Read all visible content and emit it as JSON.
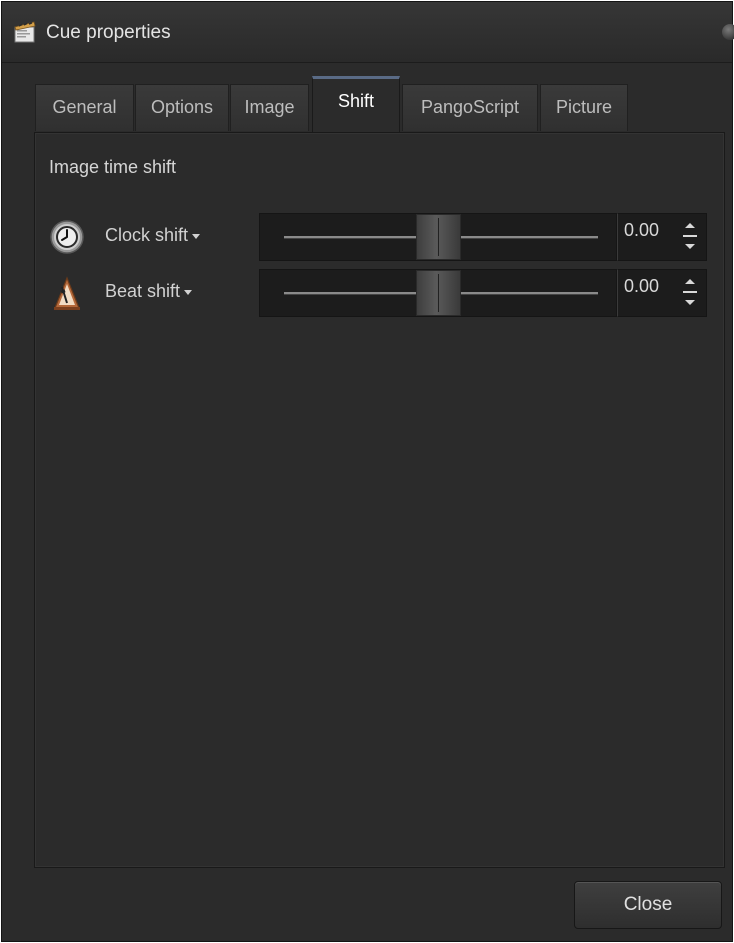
{
  "window": {
    "title": "Cue properties",
    "title_icon": "cue-properties-icon"
  },
  "tabs": [
    {
      "label": "General",
      "active": false
    },
    {
      "label": "Options",
      "active": false
    },
    {
      "label": "Image",
      "active": false
    },
    {
      "label": "Shift",
      "active": true
    },
    {
      "label": "PangoScript",
      "active": false
    },
    {
      "label": "Picture",
      "active": false
    }
  ],
  "panel": {
    "section_title": "Image time shift",
    "rows": [
      {
        "label": "Clock shift",
        "icon": "clock-icon",
        "slider_position": 0.5,
        "value": "0.00"
      },
      {
        "label": "Beat shift",
        "icon": "metronome-icon",
        "slider_position": 0.5,
        "value": "0.00"
      }
    ]
  },
  "footer": {
    "close_label": "Close"
  },
  "colors": {
    "background": "#2b2b2b",
    "active_tab_accent": "#5a6b86",
    "text": "#d2d2d2"
  }
}
